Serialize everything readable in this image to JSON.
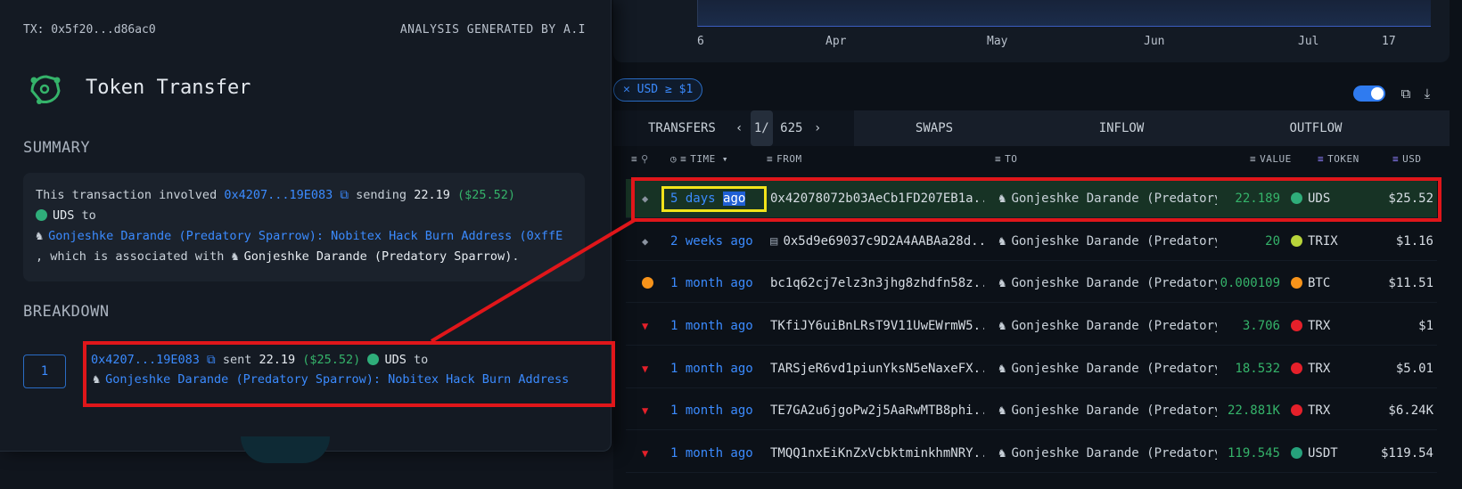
{
  "left": {
    "tx_label": "TX: 0x5f20...d86ac0",
    "ai_label": "ANALYSIS GENERATED BY A.I",
    "title": "Token Transfer",
    "summary_label": "SUMMARY",
    "summary": {
      "p1": "This transaction involved ",
      "addr": "0x4207...19E083",
      "p2": " sending ",
      "amount": "22.19",
      "usd": "($25.52)",
      "token": "UDS",
      "p3": " to",
      "dest": "Gonjeshke Darande (Predatory Sparrow): Nobitex Hack Burn Address (0xffE",
      "p4": ", which is associated with ",
      "entity": "Gonjeshke Darande (Predatory Sparrow)",
      "p5": "."
    },
    "breakdown_label": "BREAKDOWN",
    "breakdown": {
      "index": "1",
      "addr": "0x4207...19E083",
      "sent": " sent ",
      "amount": "22.19",
      "usd": "($25.52)",
      "token": "UDS",
      "to": " to",
      "dest": "Gonjeshke Darande (Predatory Sparrow): Nobitex Hack Burn Address"
    }
  },
  "chart": {
    "ticks": [
      "6",
      "Apr",
      "May",
      "Jun",
      "Jul",
      "17"
    ]
  },
  "filter": {
    "chip": "USD ≥ $1"
  },
  "tabs": {
    "transfers": "TRANSFERS",
    "page": "1/",
    "total": "625",
    "swaps": "SWAPS",
    "inflow": "INFLOW",
    "outflow": "OUTFLOW"
  },
  "columns": {
    "time": "TIME",
    "from": "FROM",
    "to": "TO",
    "value": "VALUE",
    "token": "TOKEN",
    "usd": "USD"
  },
  "rows": [
    {
      "chain": "eth",
      "time_a": "5 days",
      "time_b": "ago",
      "from": "0x42078072b03AeCb1FD207EB1a...",
      "to": "Gonjeshke Darande (Predatory",
      "value": "22.189",
      "token": "UDS",
      "token_color": "#2fae7a",
      "usd": "$25.52"
    },
    {
      "chain": "eth",
      "time": "2 weeks ago",
      "from": "0x5d9e69037c9D2A4AABAa28d...",
      "to": "Gonjeshke Darande (Predatory",
      "value": "20",
      "token": "TRIX",
      "token_color": "#b8d43a",
      "usd": "$1.16"
    },
    {
      "chain": "btc",
      "time": "1 month ago",
      "from": "bc1q62cj7elz3n3jhg8zhdfn58z...",
      "to": "Gonjeshke Darande (Predatory",
      "value": "0.000109",
      "token": "BTC",
      "token_color": "#f7931a",
      "usd": "$11.51"
    },
    {
      "chain": "trx",
      "time": "1 month ago",
      "from": "TKfiJY6uiBnLRsT9V11UwEWrmW5...",
      "to": "Gonjeshke Darande (Predatory",
      "value": "3.706",
      "token": "TRX",
      "token_color": "#e5202a",
      "usd": "$1"
    },
    {
      "chain": "trx",
      "time": "1 month ago",
      "from": "TARSjeR6vd1piunYksN5eNaxeFX...",
      "to": "Gonjeshke Darande (Predatory",
      "value": "18.532",
      "token": "TRX",
      "token_color": "#e5202a",
      "usd": "$5.01"
    },
    {
      "chain": "trx",
      "time": "1 month ago",
      "from": "TE7GA2u6jgoPw2j5AaRwMTB8phi...",
      "to": "Gonjeshke Darande (Predatory",
      "value": "22.881K",
      "token": "TRX",
      "token_color": "#e5202a",
      "usd": "$6.24K"
    },
    {
      "chain": "trx",
      "time": "1 month ago",
      "from": "TMQQ1nxEiKnZxVcbktminkhmNRY...",
      "to": "Gonjeshke Darande (Predatory",
      "value": "119.545",
      "token": "USDT",
      "token_color": "#26a17b",
      "usd": "$119.54"
    }
  ]
}
